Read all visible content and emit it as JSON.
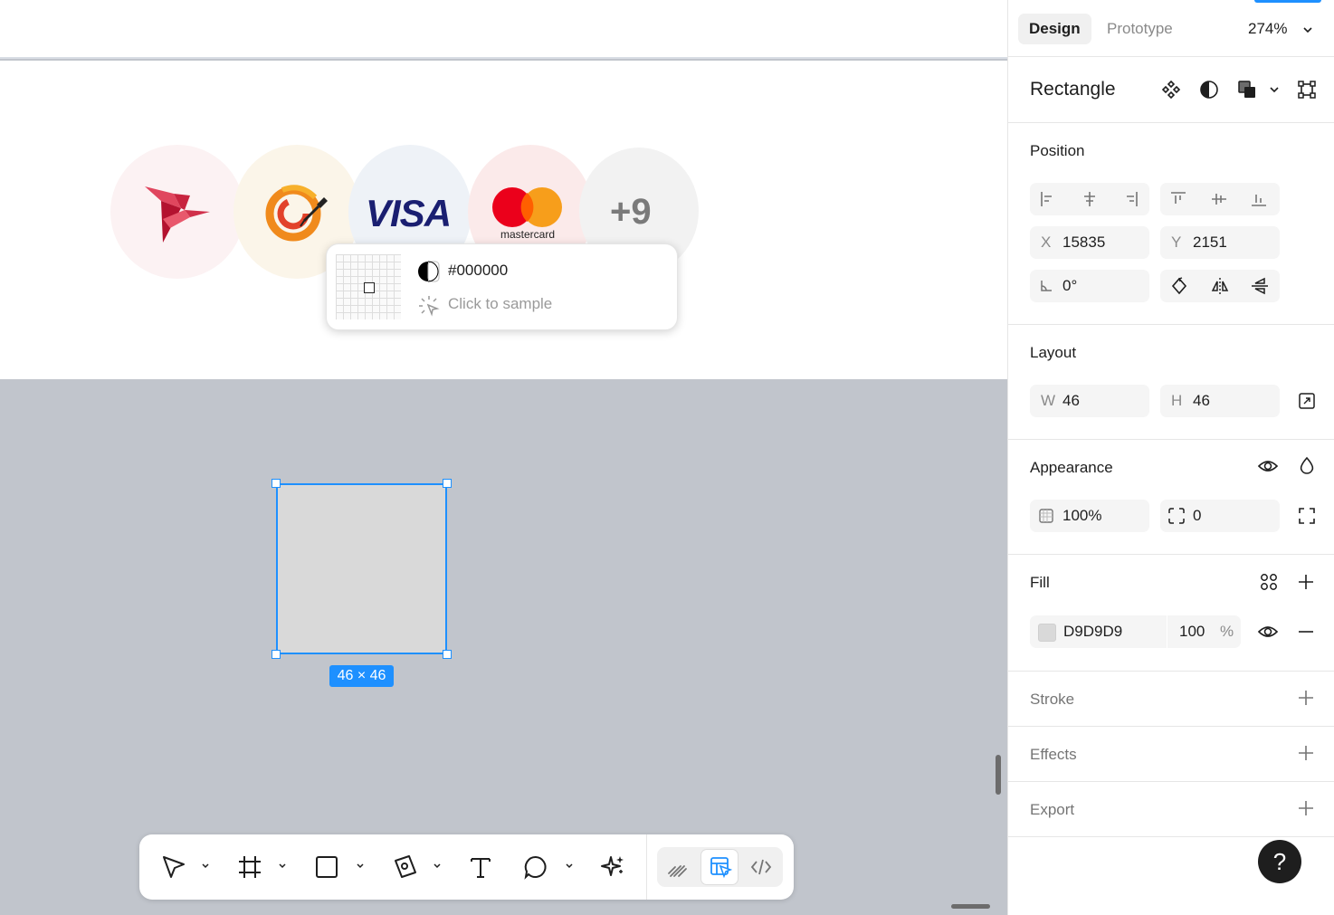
{
  "canvas": {
    "payment_icons": {
      "visa_text": "VISA",
      "mastercard_text": "mastercard",
      "more_count": "+9"
    },
    "color_picker": {
      "hex": "#000000",
      "hint": "Click to sample"
    },
    "selection": {
      "dimensions": "46 × 46",
      "fill": "#D9D9D9",
      "accent": "#1E90FF"
    }
  },
  "toolbar": {
    "tools": [
      "move-icon",
      "frame-icon",
      "rectangle-icon",
      "pen-icon",
      "text-icon",
      "comment-icon",
      "actions-icon"
    ],
    "modes": [
      "draw-mode-icon",
      "design-mode-icon",
      "dev-mode-icon"
    ],
    "active_mode": "design-mode-icon"
  },
  "panel": {
    "tabs": {
      "design": "Design",
      "prototype": "Prototype"
    },
    "zoom": "274%",
    "layer_name": "Rectangle",
    "position": {
      "title": "Position",
      "x_label": "X",
      "x_value": "15835",
      "y_label": "Y",
      "y_value": "2151",
      "rotation": "0°"
    },
    "layout": {
      "title": "Layout",
      "w_label": "W",
      "w_value": "46",
      "h_label": "H",
      "h_value": "46"
    },
    "appearance": {
      "title": "Appearance",
      "opacity": "100%",
      "radius": "0"
    },
    "fill": {
      "title": "Fill",
      "hex": "D9D9D9",
      "opacity": "100",
      "pct": "%"
    },
    "stroke": {
      "title": "Stroke"
    },
    "effects": {
      "title": "Effects"
    },
    "export": {
      "title": "Export"
    },
    "help": "?"
  }
}
